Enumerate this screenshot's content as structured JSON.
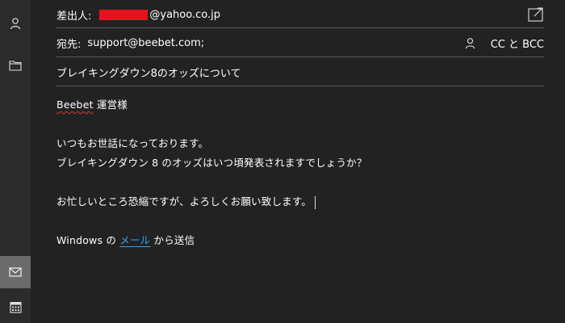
{
  "nav": {
    "icons": [
      "person-icon",
      "folder-icon",
      "mail-icon",
      "calendar-icon"
    ]
  },
  "header": {
    "from_label": "差出人:",
    "from_value": "@yahoo.co.jp",
    "to_label": "宛先:",
    "to_value": "support@beebet.com;",
    "cc_bcc_label": "CC と BCC",
    "subject": "ブレイキングダウン8のオッズについて"
  },
  "body": {
    "greeting_brand": "Beebet",
    "greeting_rest": " 運営様",
    "line1": "いつもお世話になっております。",
    "line2": "ブレイキングダウン 8 のオッズはいつ頃発表されますでしょうか？",
    "line3": "お忙しいところ恐縮ですが、よろしくお願い致します。",
    "sig_before": "Windows の ",
    "sig_link": "メール",
    "sig_after": " から送信"
  },
  "colors": {
    "background": "#222222",
    "rail": "#2b2b2b",
    "rail_active": "#6b6b6b",
    "redaction": "#e8121d",
    "link": "#3aa0e8"
  }
}
